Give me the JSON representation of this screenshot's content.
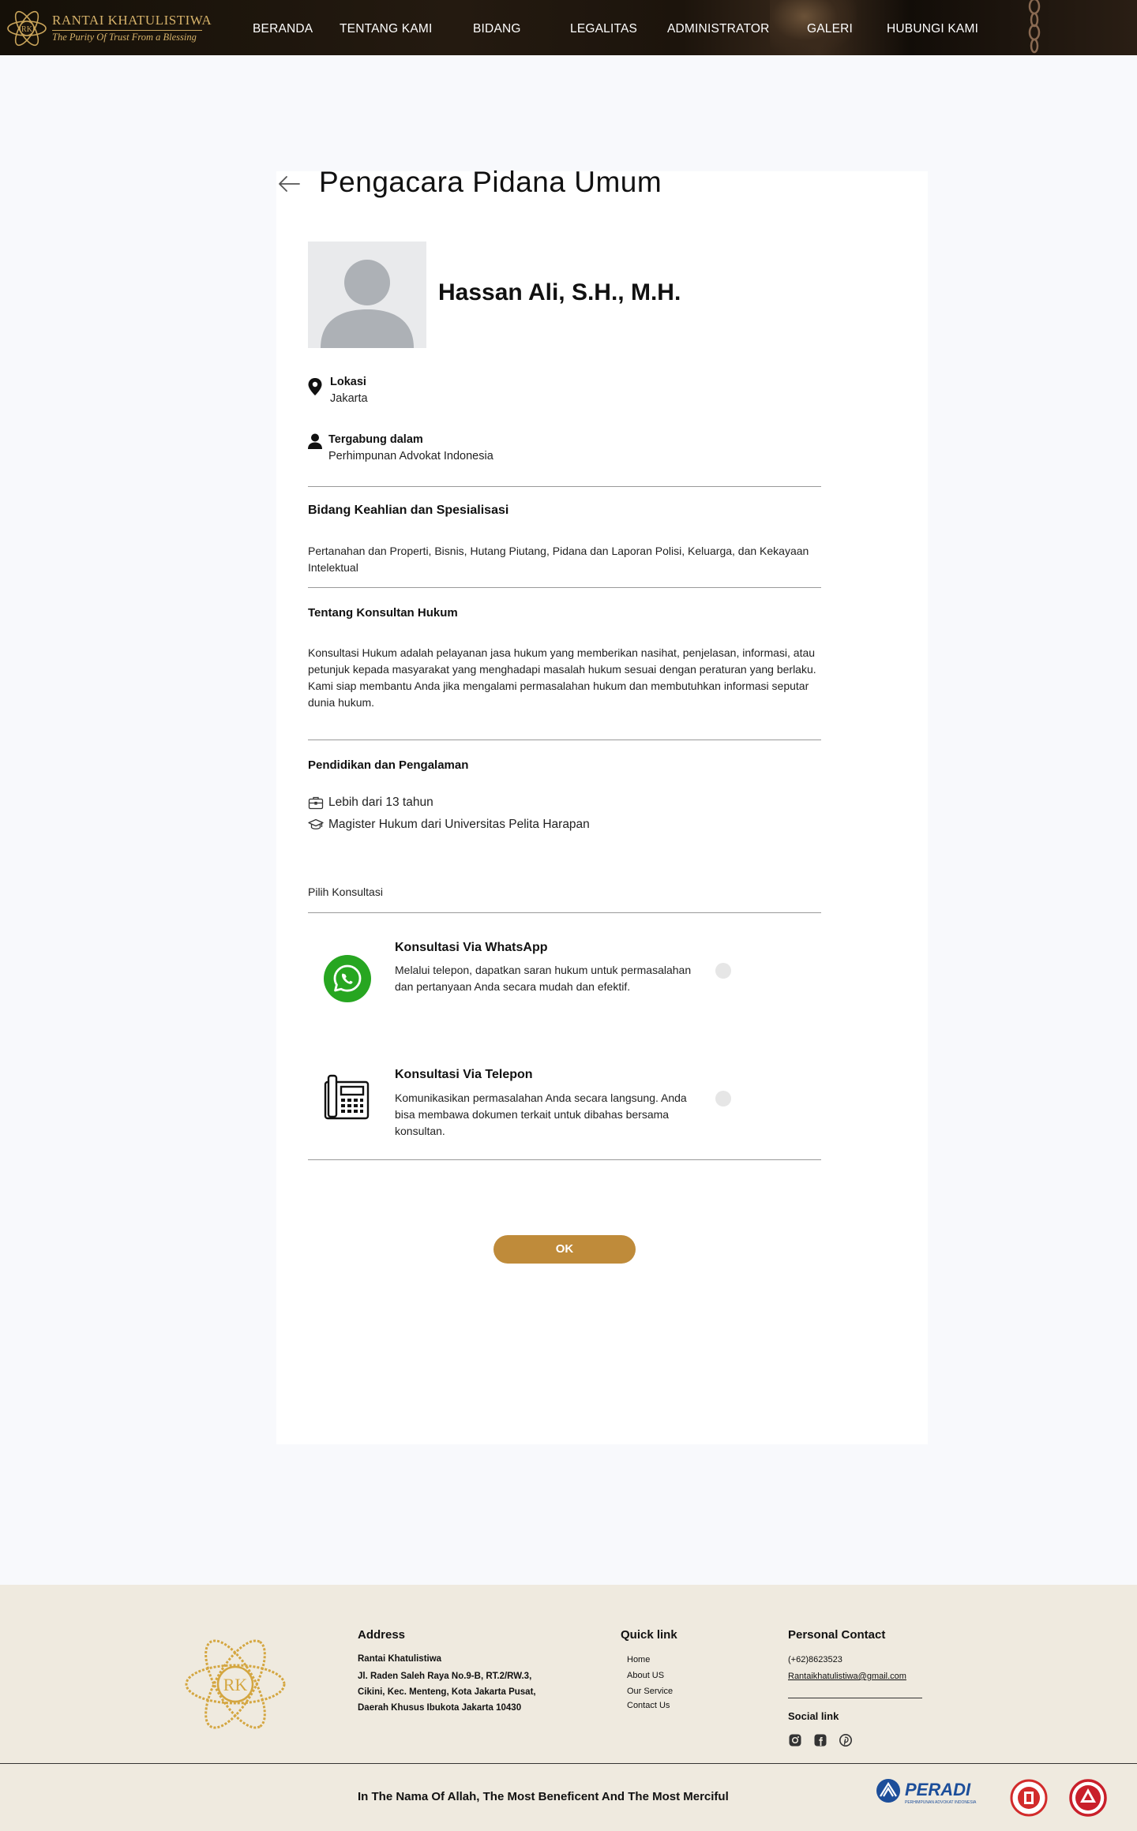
{
  "brand": {
    "name": "RANTAI KHATULISTIWA",
    "tagline": "The Purity Of Trust From a Blessing",
    "monogram": "RK"
  },
  "nav": [
    "BERANDA",
    "TENTANG KAMI",
    "BIDANG",
    "LEGALITAS",
    "ADMINISTRATOR",
    "GALERI",
    "HUBUNGI KAMI"
  ],
  "page": {
    "title": "Pengacara Pidana Umum",
    "lawyer_name": "Hassan Ali, S.H., M.H.",
    "location_label": "Lokasi",
    "location_value": "Jakarta",
    "joined_label": "Tergabung dalam",
    "joined_value": "Perhimpunan Advokat Indonesia",
    "expertise_title": "Bidang Keahlian dan Spesialisasi",
    "expertise_text": "Pertanahan dan Properti, Bisnis, Hutang Piutang, Pidana dan Laporan Polisi, Keluarga, dan Kekayaan Intelektual",
    "about_title": "Tentang Konsultan Hukum",
    "about_text": "Konsultasi Hukum adalah pelayanan jasa hukum yang memberikan nasihat, penjelasan, informasi, atau petunjuk kepada masyarakat yang menghadapi masalah hukum sesuai dengan peraturan yang berlaku. Kami siap membantu Anda jika mengalami permasalahan hukum dan membutuhkan informasi seputar dunia hukum.",
    "education_title": "Pendidikan dan Pengalaman",
    "experience": "Lebih dari 13 tahun",
    "education": "Magister Hukum dari Universitas Pelita Harapan",
    "choose_label": "Pilih Konsultasi",
    "options": [
      {
        "title": "Konsultasi Via WhatsApp",
        "desc": "Melalui telepon, dapatkan saran hukum untuk permasalahan dan pertanyaan Anda secara mudah dan efektif.",
        "icon": "whatsapp-icon"
      },
      {
        "title": "Konsultasi Via Telepon",
        "desc": "Komunikasikan permasalahan Anda secara langsung. Anda bisa membawa dokumen terkait untuk dibahas bersama konsultan.",
        "icon": "telephone-icon"
      }
    ],
    "ok_label": "OK"
  },
  "footer": {
    "monogram": "RK",
    "address_title": "Address",
    "address_lines": [
      "Rantai Khatulistiwa",
      "Jl. Raden Saleh Raya No.9-B, RT.2/RW.3,",
      "Cikini, Kec. Menteng, Kota Jakarta Pusat,",
      "Daerah Khusus Ibukota Jakarta 10430"
    ],
    "quicklink_title": "Quick link",
    "quicklinks": [
      "Home",
      "About US",
      "Our Service",
      "Contact Us"
    ],
    "contact_title": "Personal Contact",
    "phone": "(+62)8623523",
    "email": "Rantaikhatulistiwa@gmail.com",
    "social_title": "Social link",
    "motto": "In The Nama Of Allah, The Most Beneficent And The Most Merciful",
    "peradi": "PERADI",
    "peradi_sub": "PERHIMPUNAN ADVOKAT INDONESIA"
  },
  "colors": {
    "accent": "#bf8b3a",
    "gold": "#d6b26a",
    "whatsapp": "#27a621",
    "footer_bg": "#efeadf",
    "peradi_blue": "#1c4e9a"
  }
}
